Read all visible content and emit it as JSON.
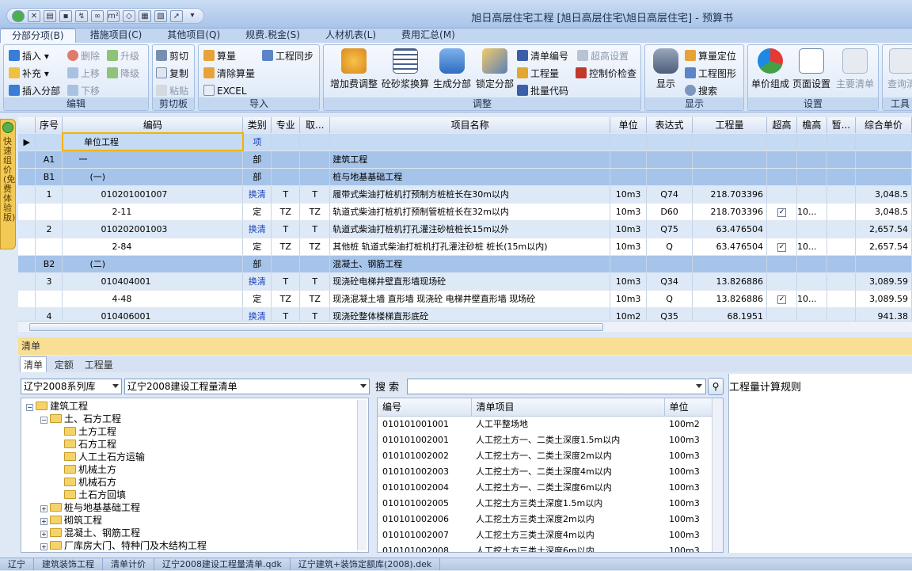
{
  "window": {
    "title": "旭日高层住宅工程 [旭日高层住宅\\旭日高层住宅] - 预算书"
  },
  "tabs": [
    "分部分项(B)",
    "措施项目(C)",
    "其他项目(Q)",
    "规费.税金(S)",
    "人材机表(L)",
    "费用汇总(M)"
  ],
  "ribbon": {
    "edit": {
      "insert": "插入",
      "delete": "删除",
      "up_level": "升级",
      "supplement": "补充",
      "move_up": "上移",
      "down_level": "降级",
      "insert_part": "插入分部",
      "move_down": "下移",
      "label": "编辑"
    },
    "clipboard": {
      "cut": "剪切",
      "copy": "复制",
      "paste": "粘贴",
      "label": "剪切板"
    },
    "import": {
      "calc": "算量",
      "sync": "工程同步",
      "clear": "清除算量",
      "excel": "EXCEL",
      "label": "导入"
    },
    "adjust": {
      "add_fee": "增加费调整",
      "mortar": "砼砂浆换算",
      "gen_part": "生成分部",
      "lock_part": "锁定分部",
      "list_code": "清单编号",
      "work_qty": "工程量",
      "batch_code": "批量代码",
      "height_set": "超高设置",
      "control_check": "控制价检查",
      "label": "调整"
    },
    "display": {
      "show": "显示",
      "locate": "算量定位",
      "graph": "工程图形",
      "search": "搜索",
      "label": "显示"
    },
    "settings": {
      "unit_price": "单价组成",
      "page_set": "页面设置",
      "main_list": "主要清单",
      "label": "设置"
    },
    "tools": {
      "query": "查询清",
      "label": "工具"
    }
  },
  "left_strip": "快速组价(免费体验版)",
  "grid": {
    "headers": [
      "序号",
      "编码",
      "类别",
      "专业",
      "取...",
      "项目名称",
      "单位",
      "表达式",
      "工程量",
      "超高",
      "檐高",
      "暂...",
      "综合单价"
    ],
    "rows": [
      {
        "seq": "",
        "code": "单位工程",
        "type": "项",
        "major": "",
        "fee": "",
        "name": "",
        "unit": "",
        "expr": "",
        "qty": "",
        "super": false,
        "eave": "",
        "price": ""
      },
      {
        "seq": "A1",
        "code": "一",
        "type": "部",
        "major": "",
        "fee": "",
        "name": "建筑工程",
        "unit": "",
        "expr": "",
        "qty": "",
        "super": false,
        "eave": "",
        "price": ""
      },
      {
        "seq": "B1",
        "code": "(一)",
        "type": "部",
        "major": "",
        "fee": "",
        "name": "桩与地基基础工程",
        "unit": "",
        "expr": "",
        "qty": "",
        "super": false,
        "eave": "",
        "price": ""
      },
      {
        "seq": "1",
        "code": "010201001007",
        "type": "换清",
        "major": "T",
        "fee": "T",
        "name": "履带式柴油打桩机打预制方桩桩长在30m以内",
        "unit": "10m3",
        "expr": "Q74",
        "qty": "218.703396",
        "super": false,
        "eave": "",
        "price": "3,048.5"
      },
      {
        "seq": "",
        "code": "2-11",
        "type": "定",
        "major": "TZ",
        "fee": "TZ",
        "name": "轨道式柴油打桩机打预制管桩桩长在32m以内",
        "unit": "10m3",
        "expr": "D60",
        "qty": "218.703396",
        "super": true,
        "eave": "10...",
        "price": "3,048.5"
      },
      {
        "seq": "2",
        "code": "010202001003",
        "type": "换清",
        "major": "T",
        "fee": "T",
        "name": "轨道式柴油打桩机打孔灌注砂桩桩长15m以外",
        "unit": "10m3",
        "expr": "Q75",
        "qty": "63.476504",
        "super": false,
        "eave": "",
        "price": "2,657.54"
      },
      {
        "seq": "",
        "code": "2-84",
        "type": "定",
        "major": "TZ",
        "fee": "TZ",
        "name": "其他桩 轨道式柴油打桩机打孔灌注砂桩 桩长(15m以内)",
        "unit": "10m3",
        "expr": "Q",
        "qty": "63.476504",
        "super": true,
        "eave": "10...",
        "price": "2,657.54"
      },
      {
        "seq": "B2",
        "code": "(二)",
        "type": "部",
        "major": "",
        "fee": "",
        "name": "混凝土、钢筋工程",
        "unit": "",
        "expr": "",
        "qty": "",
        "super": false,
        "eave": "",
        "price": ""
      },
      {
        "seq": "3",
        "code": "010404001",
        "type": "换清",
        "major": "T",
        "fee": "T",
        "name": "现浇砼电梯井壁直形墙现场砼",
        "unit": "10m3",
        "expr": "Q34",
        "qty": "13.826886",
        "super": false,
        "eave": "",
        "price": "3,089.59"
      },
      {
        "seq": "",
        "code": "4-48",
        "type": "定",
        "major": "TZ",
        "fee": "TZ",
        "name": "现浇混凝土墙 直形墙 现浇砼 电梯井壁直形墙 现场砼",
        "unit": "10m3",
        "expr": "Q",
        "qty": "13.826886",
        "super": true,
        "eave": "10...",
        "price": "3,089.59"
      },
      {
        "seq": "4",
        "code": "010406001",
        "type": "换清",
        "major": "T",
        "fee": "T",
        "name": "现浇砼整体楼梯直形底砼",
        "unit": "10m2",
        "expr": "Q35",
        "qty": "68.1951",
        "super": false,
        "eave": "",
        "price": "941.38"
      }
    ]
  },
  "bottom": {
    "section_title": "清单",
    "subtabs": [
      "清单",
      "定额",
      "工程量"
    ],
    "lib_select": "辽宁2008系列库",
    "list_select": "辽宁2008建设工程量清单",
    "tree": [
      {
        "label": "建筑工程",
        "level": 0,
        "toggle": "−"
      },
      {
        "label": "土、石方工程",
        "level": 1,
        "toggle": "−"
      },
      {
        "label": "土方工程",
        "level": 2,
        "toggle": ""
      },
      {
        "label": "石方工程",
        "level": 2,
        "toggle": ""
      },
      {
        "label": "人工土石方运输",
        "level": 2,
        "toggle": ""
      },
      {
        "label": "机械土方",
        "level": 2,
        "toggle": ""
      },
      {
        "label": "机械石方",
        "level": 2,
        "toggle": ""
      },
      {
        "label": "土石方回填",
        "level": 2,
        "toggle": ""
      },
      {
        "label": "桩与地基基础工程",
        "level": 1,
        "toggle": "+"
      },
      {
        "label": "砌筑工程",
        "level": 1,
        "toggle": "+"
      },
      {
        "label": "混凝土、钢筋工程",
        "level": 1,
        "toggle": "+"
      },
      {
        "label": "厂库房大门、特种门及木结构工程",
        "level": 1,
        "toggle": "+"
      }
    ],
    "search_label": "搜 索",
    "search_value": "",
    "list_headers": [
      "编号",
      "清单项目",
      "单位"
    ],
    "list_rows": [
      [
        "010101001001",
        "人工平整场地",
        "100m2"
      ],
      [
        "010101002001",
        "人工挖土方一、二类土深度1.5m以内",
        "100m3"
      ],
      [
        "010101002002",
        "人工挖土方一、二类土深度2m以内",
        "100m3"
      ],
      [
        "010101002003",
        "人工挖土方一、二类土深度4m以内",
        "100m3"
      ],
      [
        "010101002004",
        "人工挖土方一、二类土深度6m以内",
        "100m3"
      ],
      [
        "010101002005",
        "人工挖土方三类土深度1.5m以内",
        "100m3"
      ],
      [
        "010101002006",
        "人工挖土方三类土深度2m以内",
        "100m3"
      ],
      [
        "010101002007",
        "人工挖土方三类土深度4m以内",
        "100m3"
      ],
      [
        "010101002008",
        "人工挖土方三类土深度6m以内",
        "100m3"
      ]
    ],
    "rules_title": "工程量计算规则"
  },
  "taskbar": [
    "辽宁",
    "建筑装饰工程",
    "清单计价",
    "辽宁2008建设工程量清单.qdk",
    "辽宁建筑+装饰定额库(2008).dek"
  ]
}
